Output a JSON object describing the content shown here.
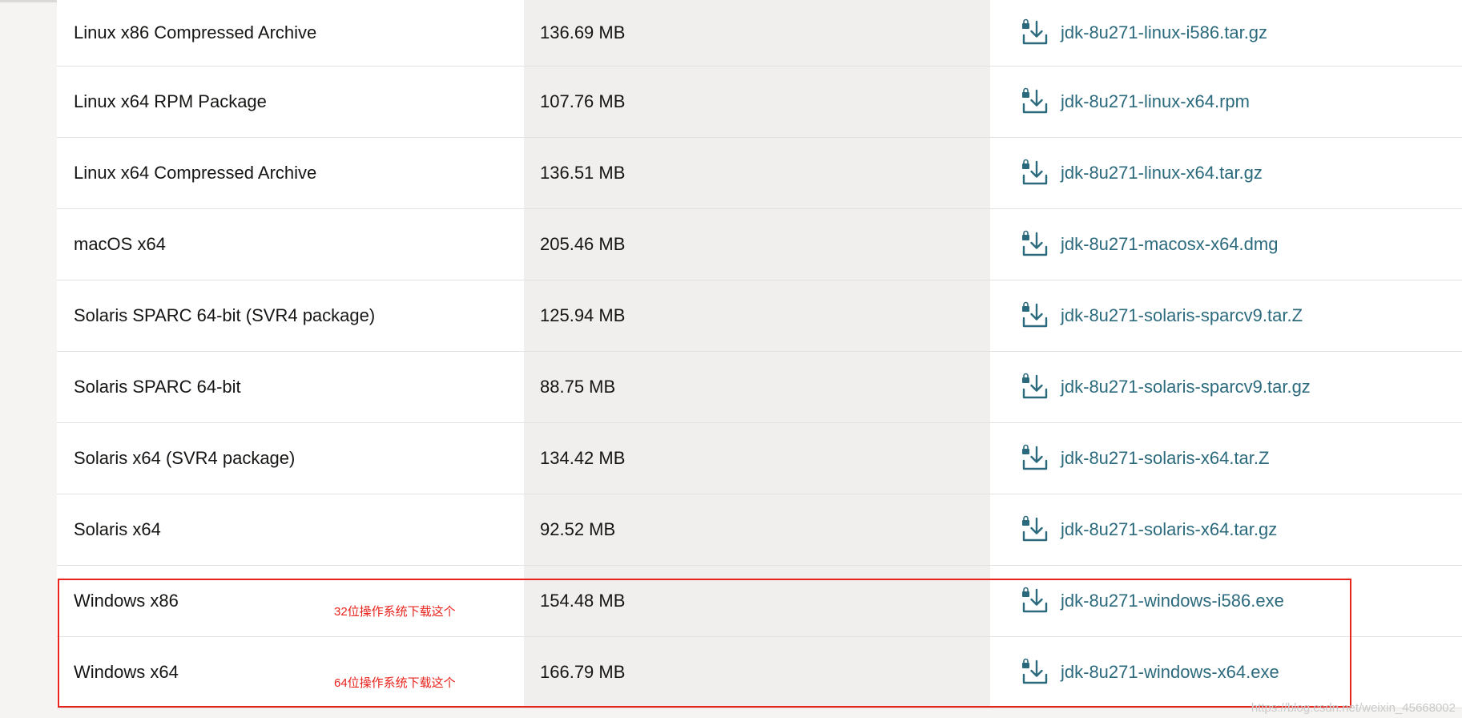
{
  "table": {
    "rows": [
      {
        "product": "Linux x86 Compressed Archive",
        "size": "136.69 MB",
        "file": "jdk-8u271-linux-i586.tar.gz",
        "note": ""
      },
      {
        "product": "Linux x64 RPM Package",
        "size": "107.76 MB",
        "file": "jdk-8u271-linux-x64.rpm",
        "note": ""
      },
      {
        "product": "Linux x64 Compressed Archive",
        "size": "136.51 MB",
        "file": "jdk-8u271-linux-x64.tar.gz",
        "note": ""
      },
      {
        "product": "macOS x64",
        "size": "205.46 MB",
        "file": "jdk-8u271-macosx-x64.dmg",
        "note": ""
      },
      {
        "product": "Solaris SPARC 64-bit (SVR4 package)",
        "size": "125.94 MB",
        "file": "jdk-8u271-solaris-sparcv9.tar.Z",
        "note": ""
      },
      {
        "product": "Solaris SPARC 64-bit",
        "size": "88.75 MB",
        "file": "jdk-8u271-solaris-sparcv9.tar.gz",
        "note": ""
      },
      {
        "product": "Solaris x64 (SVR4 package)",
        "size": "134.42 MB",
        "file": "jdk-8u271-solaris-x64.tar.Z",
        "note": ""
      },
      {
        "product": "Solaris x64",
        "size": "92.52 MB",
        "file": "jdk-8u271-solaris-x64.tar.gz",
        "note": ""
      },
      {
        "product": "Windows x86",
        "size": "154.48 MB",
        "file": "jdk-8u271-windows-i586.exe",
        "note": "32位操作系统下载这个"
      },
      {
        "product": "Windows x64",
        "size": "166.79 MB",
        "file": "jdk-8u271-windows-x64.exe",
        "note": "64位操作系统下载这个"
      }
    ]
  },
  "icons": {
    "download": "download-icon",
    "lock": "lock-icon"
  },
  "colors": {
    "link": "#2b6a7d",
    "annotation": "#e8231c"
  },
  "watermark": "https://blog.csdn.net/weixin_45668002"
}
